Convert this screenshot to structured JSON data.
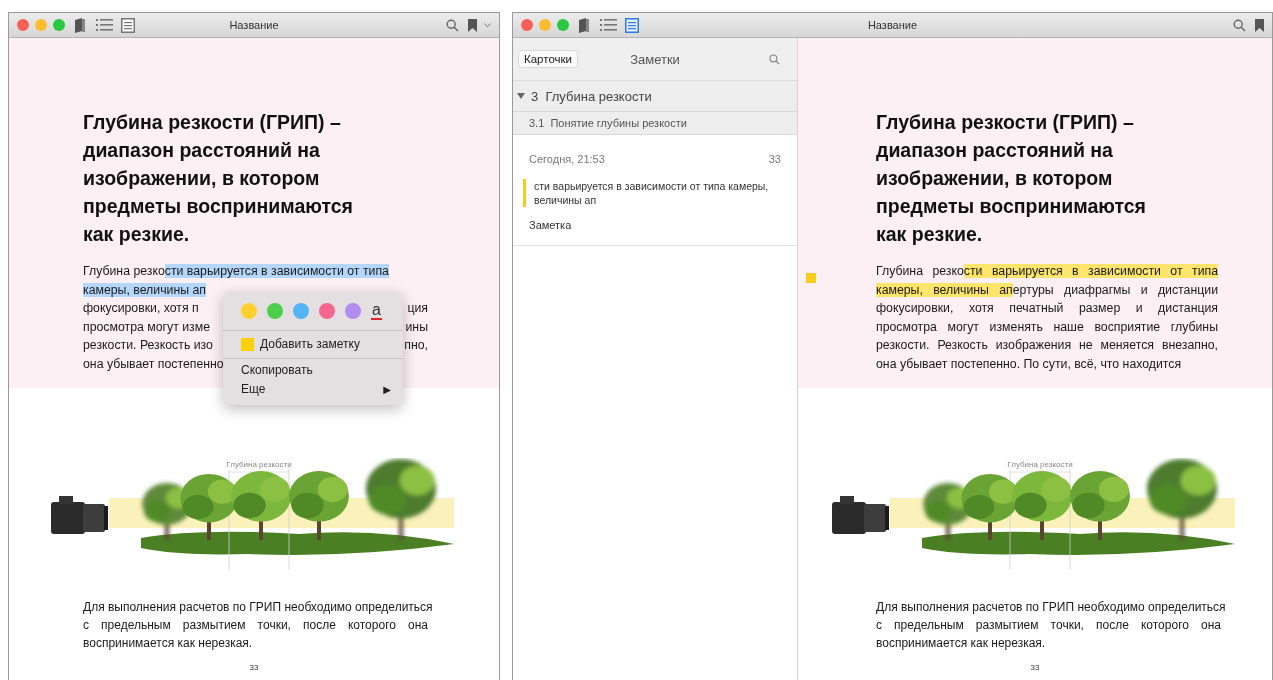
{
  "windows": [
    {
      "title": "Название",
      "bookmark_caret": true,
      "view_buttons": [
        {
          "kind": "library",
          "selected": false
        },
        {
          "kind": "contents",
          "selected": false
        },
        {
          "kind": "notes",
          "selected": false
        }
      ],
      "page": {
        "heading_lines": [
          "Глубина резкости (ГРИП) –",
          "диапазон расстояний на",
          "изображении, в котором",
          "предметы воспринимаются",
          "как резкие."
        ],
        "paragraph": {
          "color": "#b5d6fb",
          "lines": [
            {
              "segments": [
                {
                  "text": "Глубина резко",
                  "highlighted": false
                },
                {
                  "text": "сти варьируется в зависимости от типа",
                  "highlighted": true
                }
              ]
            },
            {
              "segments": [
                {
                  "text": "камеры, величины ап",
                  "highlighted": true
                }
              ]
            },
            {
              "segments": [
                {
                  "text": "фокусировки, хотя п",
                  "highlighted": false
                }
              ],
              "right": "ция"
            },
            {
              "segments": [
                {
                  "text": "просмотра могут изме",
                  "highlighted": false
                }
              ],
              "right": "ины"
            },
            {
              "segments": [
                {
                  "text": "резкости. Резкость изо",
                  "highlighted": false
                }
              ],
              "right": "пно,"
            },
            {
              "segments": [
                {
                  "text": "она убывает постепенно",
                  "highlighted": false
                }
              ]
            }
          ]
        },
        "diagram_label": "Глубина резкости",
        "body_lines": [
          "Для выполнения расчетов по ГРИП необходимо определиться",
          "с предельным размытием точки, после которого она",
          "воспринимается как нерезкая."
        ],
        "page_number": "33"
      },
      "context_menu": {
        "colors": [
          {
            "color": "#ffd02f"
          },
          {
            "color": "#4cd04c"
          },
          {
            "color": "#55b4f5"
          },
          {
            "color": "#f7668f"
          },
          {
            "color": "#b38cf0"
          }
        ],
        "underline_label": "a",
        "groups": [
          [
            {
              "kind": "note",
              "label": "Добавить заметку"
            }
          ],
          [
            {
              "kind": "action",
              "label": "Скопировать"
            },
            {
              "kind": "submenu",
              "label": "Еще",
              "arrow": "▶"
            }
          ]
        ]
      }
    },
    {
      "title": "Название",
      "view_buttons": [
        {
          "kind": "library",
          "selected": false
        },
        {
          "kind": "contents",
          "selected": false
        },
        {
          "kind": "notes",
          "selected": true
        }
      ],
      "sidebar": {
        "cards_button": "Карточки",
        "title": "Заметки",
        "chapter": {
          "number": "3",
          "title": "Глубина резкости",
          "expanded": true
        },
        "section": {
          "number": "3.1",
          "title": "Понятие глубины резкости"
        },
        "notes": [
          {
            "date": "Сегодня, 21:53",
            "page": "33",
            "quote": "сти варьируется в зависимости от типа камеры, величины ап",
            "text": "Заметка",
            "color": "#f7cc1f"
          }
        ]
      },
      "page": {
        "note_marker": true,
        "heading_lines": [
          "Глубина резкости (ГРИП) –",
          "диапазон расстояний на",
          "изображении, в котором",
          "предметы воспринимаются",
          "как резкие."
        ],
        "paragraph": {
          "color": "#fde46a",
          "lines": [
            {
              "segments": [
                {
                  "text": "Глубина резко",
                  "highlighted": false
                },
                {
                  "text": "сти варьируется в зависимости от типа",
                  "highlighted": true
                }
              ]
            },
            {
              "segments": [
                {
                  "text": "камеры, величины ап",
                  "highlighted": true
                },
                {
                  "text": "ертуры диафрагмы и дистанции",
                  "highlighted": false
                }
              ]
            },
            {
              "segments": [
                {
                  "text": "фокусировки, хотя печатный размер и дистанция",
                  "highlighted": false
                }
              ]
            },
            {
              "segments": [
                {
                  "text": "просмотра могут изменять наше восприятие глубины",
                  "highlighted": false
                }
              ]
            },
            {
              "segments": [
                {
                  "text": "резкости. Резкость изображения не меняется внезапно,",
                  "highlighted": false
                }
              ]
            },
            {
              "segments": [
                {
                  "text": "она убывает постепенно. По сути, всё, что находится",
                  "highlighted": false
                }
              ]
            }
          ]
        },
        "diagram_label": "Глубина резкости",
        "body_lines": [
          "Для выполнения расчетов по ГРИП необходимо определиться",
          "с предельным размытием точки, после которого она",
          "воспринимается как нерезкая."
        ],
        "page_number": "33"
      }
    }
  ]
}
